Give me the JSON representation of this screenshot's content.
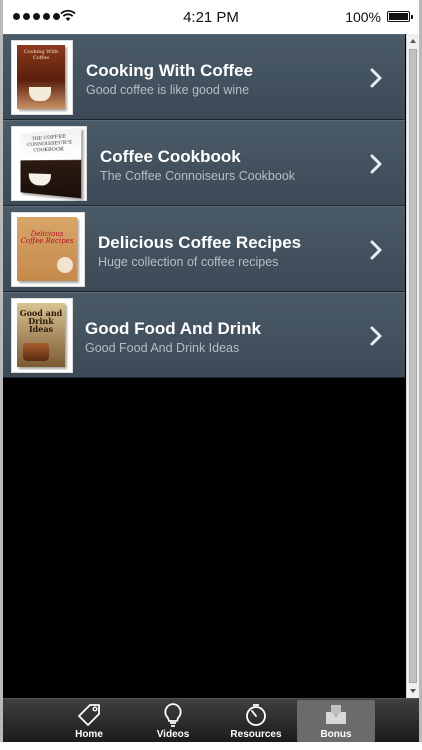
{
  "status_bar": {
    "time": "4:21 PM",
    "battery": "100%"
  },
  "list": {
    "items": [
      {
        "title": "Cooking With Coffee",
        "subtitle": "Good coffee is like good wine",
        "cover_text": "Cooking With Coffee"
      },
      {
        "title": "Coffee Cookbook",
        "subtitle": "The Coffee Connoiseurs Cookbook",
        "cover_text": "THE COFFEE CONNOISSEUR'S COOKBOOK"
      },
      {
        "title": "Delicious Coffee Recipes",
        "subtitle": "Huge collection of coffee recipes",
        "cover_text": "Delicious Coffee Recipes"
      },
      {
        "title": "Good Food And Drink",
        "subtitle": "Good Food And Drink Ideas",
        "cover_text": "Good and Drink Ideas"
      }
    ]
  },
  "tab_bar": {
    "tabs": [
      {
        "label": "Home",
        "icon": "tag-icon"
      },
      {
        "label": "Videos",
        "icon": "lightbulb-icon"
      },
      {
        "label": "Resources",
        "icon": "stopwatch-icon"
      },
      {
        "label": "Bonus",
        "icon": "inbox-icon",
        "active": true
      }
    ]
  },
  "colors": {
    "list_item_bg": "#44535f",
    "title_text": "#ffffff",
    "subtitle_text": "#b4bec6",
    "tab_active_bg": "#6b6b6b"
  }
}
